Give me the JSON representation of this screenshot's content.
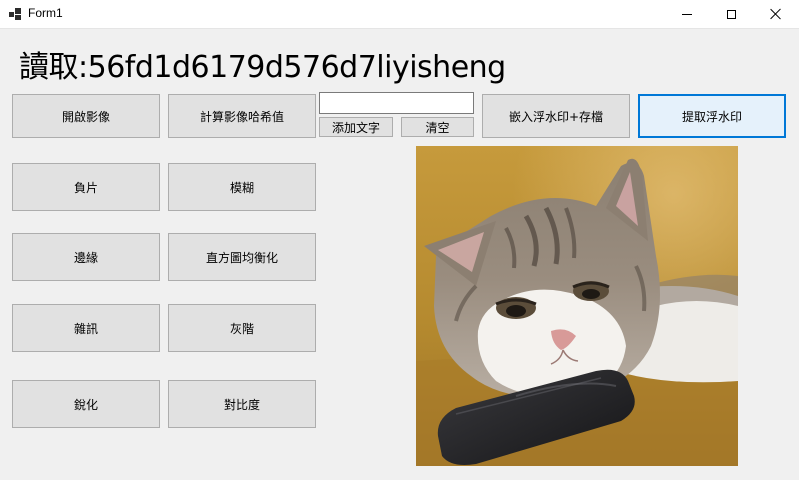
{
  "window": {
    "title": "Form1",
    "minimize_icon": "minimize-icon",
    "maximize_icon": "maximize-icon",
    "close_icon": "close-icon"
  },
  "label": {
    "text": "讀取:56fd1d6179d576d7liyisheng"
  },
  "toolbar": {
    "open_image": "開啟影像",
    "compute_hash": "計算影像哈希值",
    "text_input_value": "",
    "add_text": "添加文字",
    "clear": "清空",
    "embed_save": "嵌入浮水印+存檔",
    "extract": "提取浮水印"
  },
  "filters": {
    "negative": "負片",
    "blur": "模糊",
    "edge": "邊緣",
    "hist_eq": "直方圖均衡化",
    "noise": "雜訊",
    "grayscale": "灰階",
    "sharpen": "銳化",
    "contrast": "對比度"
  },
  "image": {
    "subject": "cat-resting-head-on-phone",
    "colors": {
      "background": "#c8962f",
      "cat_white": "#f2f0ec",
      "cat_tabby": "#8a7c6e",
      "phone": "#1c1c1e"
    }
  },
  "colors": {
    "form_bg": "#f0f0f0",
    "button_bg": "#e1e1e1",
    "button_border": "#adadad",
    "focus_border": "#0078d7"
  }
}
